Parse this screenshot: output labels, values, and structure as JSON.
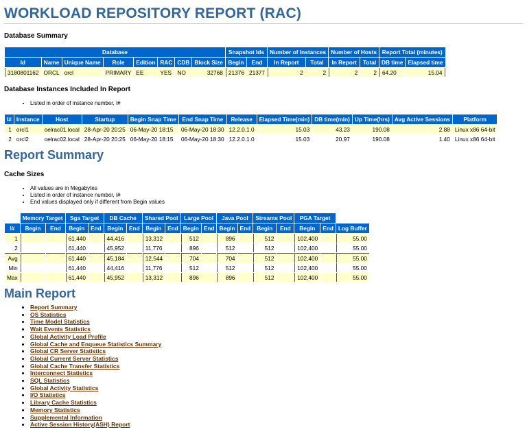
{
  "title": "WORKLOAD REPOSITORY REPORT (RAC)",
  "db_summary": {
    "heading": "Database Summary",
    "group_headers": [
      "Database",
      "Snapshot Ids",
      "Number of Instances",
      "Number of Hosts",
      "Report Total (minutes)"
    ],
    "columns": [
      "Id",
      "Name",
      "Unique Name",
      "Role",
      "Edition",
      "RAC",
      "CDB",
      "Block Size",
      "Begin",
      "End",
      "In Report",
      "Total",
      "In Report",
      "Total",
      "DB time",
      "Elapsed time"
    ],
    "row": [
      "3180801162",
      "ORCL",
      "orcl",
      "PRIMARY",
      "EE",
      "YES",
      "NO",
      "32768",
      "21376",
      "21377",
      "2",
      "2",
      "2",
      "2",
      "64.20",
      "15.04"
    ]
  },
  "instances": {
    "heading": "Database Instances Included In Report",
    "notes": [
      "Listed in order of instance number, I#"
    ],
    "columns": [
      "I#",
      "Instance",
      "Host",
      "Startup",
      "Begin Snap Time",
      "End Snap Time",
      "Release",
      "Elapsed Time(min)",
      "DB time(min)",
      "Up Time(hrs)",
      "Avg Active Sessions",
      "Platform"
    ],
    "rows": [
      [
        "1",
        "orcl1",
        "oelrac01.local",
        "28-Apr-20 20:25",
        "06-May-20 18:15",
        "06-May-20 18:30",
        "12.2.0.1.0",
        "15.03",
        "43.23",
        "190.08",
        "2.88",
        "Linux x86 64-bit"
      ],
      [
        "2",
        "orcl2",
        "oelrac02.local",
        "28-Apr-20 20:25",
        "06-May-20 18:15",
        "06-May-20 18:30",
        "12.2.0.1.0",
        "15.03",
        "20.97",
        "190.08",
        "1.40",
        "Linux x86 64-bit"
      ]
    ]
  },
  "report_summary": {
    "heading": "Report Summary",
    "cache_heading": "Cache Sizes",
    "notes": [
      "All values are in Megabytes",
      "Listed in order of instance number, I#",
      "End values displayed only if different from Begin values"
    ],
    "group_headers": [
      "Memory Target",
      "Sga Target",
      "DB Cache",
      "Shared Pool",
      "Large Pool",
      "Java Pool",
      "Streams Pool",
      "PGA Target"
    ],
    "columns": [
      "I#",
      "Begin",
      "End",
      "Begin",
      "End",
      "Begin",
      "End",
      "Begin",
      "End",
      "Begin",
      "End",
      "Begin",
      "End",
      "Begin",
      "End",
      "Begin",
      "End",
      "Log Buffer"
    ],
    "rows": [
      [
        "1",
        "",
        "",
        "61,440",
        "",
        "44,416",
        "",
        "13,312",
        "",
        "512",
        "",
        "896",
        "",
        "512",
        "",
        "102,400",
        "",
        "55.00"
      ],
      [
        "2",
        "",
        "",
        "61,440",
        "",
        "45,952",
        "",
        "11,776",
        "",
        "896",
        "",
        "512",
        "",
        "512",
        "",
        "102,400",
        "",
        "55.00"
      ],
      [
        "Avg",
        "",
        "",
        "61,440",
        "",
        "45,184",
        "",
        "12,544",
        "",
        "704",
        "",
        "704",
        "",
        "512",
        "",
        "102,400",
        "",
        "55.00"
      ],
      [
        "Min",
        "",
        "",
        "61,440",
        "",
        "44,416",
        "",
        "11,776",
        "",
        "512",
        "",
        "512",
        "",
        "512",
        "",
        "102,400",
        "",
        "55.00"
      ],
      [
        "Max",
        "",
        "",
        "61,440",
        "",
        "45,952",
        "",
        "13,312",
        "",
        "896",
        "",
        "896",
        "",
        "512",
        "",
        "102,400",
        "",
        "55.00"
      ]
    ]
  },
  "main_report": {
    "heading": "Main Report",
    "links": [
      "Report Summary",
      "OS Statistics",
      "Time Model Statistics",
      "Wait Events Statistics",
      "Global Activity Load Profile",
      "Global Cache and Enqueue Statistics Summary",
      "Global CR Server Statistics",
      "Global Current Server Statistics",
      "Global Cache Transfer Statistics",
      "Interconnect Statistics",
      "SQL Statistics",
      "Global Activity Statistics",
      "I/O Statistics",
      "Library Cache Statistics",
      "Memory Statistics",
      "Supplemental Information",
      "Active Session History(ASH) Report"
    ]
  },
  "colors": {
    "header_bg": "#0066cc",
    "heading": "#336699",
    "odd_row": "#ffffcc",
    "link": "#663300"
  }
}
